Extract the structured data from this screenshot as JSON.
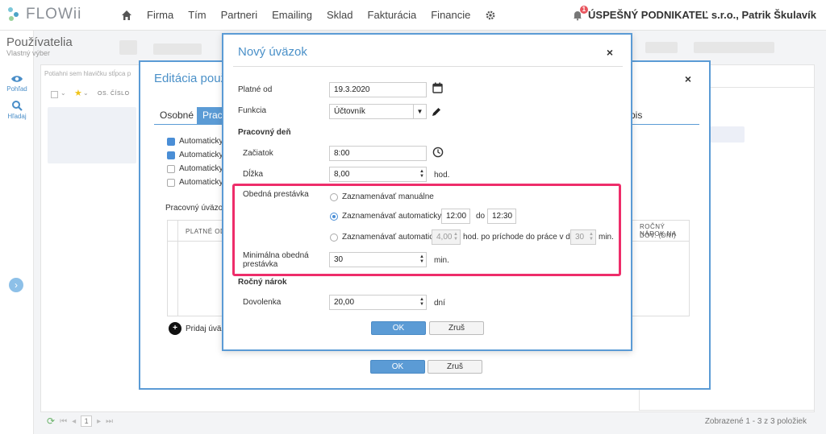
{
  "brand": {
    "name": "FLOWii",
    "colors": {
      "accent": "#5b9bd5",
      "highlight": "#ee2d6a",
      "notification": "#e8545d"
    }
  },
  "nav": {
    "items": [
      "Firma",
      "Tím",
      "Partneri",
      "Emailing",
      "Sklad",
      "Fakturácia",
      "Financie"
    ],
    "home_icon": "home-icon",
    "settings_icon": "gear-icon"
  },
  "user": {
    "name": "ÚSPEŠNÝ PODNIKATEĽ s.r.o., Patrik Škulavík",
    "notifications": "1"
  },
  "sidebar": {
    "items": [
      {
        "label": "Pohľad",
        "icon": "eye-icon"
      },
      {
        "label": "Hľadaj",
        "icon": "search-icon"
      }
    ]
  },
  "page": {
    "title": "Používatelia",
    "subtitle": "Vlastný výber",
    "hint": "Potiahni sem hlavičku stĺpca p",
    "column_num": "OS. ČÍSLO"
  },
  "footer": {
    "page": "1",
    "total": "Zobrazené 1 - 3 z 3 položiek"
  },
  "back_dialog": {
    "title": "Editácia použ",
    "tabs": [
      "Osobné",
      "Prac",
      "pis"
    ],
    "checkboxes": [
      {
        "label": "Automaticky n",
        "checked": true
      },
      {
        "label": "Automaticky s",
        "checked": true
      },
      {
        "label": "Automaticky u",
        "checked": false
      },
      {
        "label": "Automaticky z",
        "checked": false
      }
    ],
    "section": "Pracovný úväzok",
    "columns": [
      "PLATNÉ OD",
      "ROČNÝ NÁROK NA",
      "DOV. (DNI)"
    ],
    "add_label": "Pridaj úväzo",
    "ok": "OK",
    "cancel": "Zruš"
  },
  "dialog": {
    "title": "Nový úväzok",
    "valid_from": {
      "label": "Platné od",
      "value": "19.3.2020"
    },
    "function": {
      "label": "Funkcia",
      "value": "Účtovník"
    },
    "workday": {
      "heading": "Pracovný deň",
      "start": {
        "label": "Začiatok",
        "value": "8:00"
      },
      "length": {
        "label": "Dĺžka",
        "value": "8,00",
        "unit": "hod."
      }
    },
    "lunch": {
      "label": "Obedná prestávka",
      "manual": "Zaznamenávať manuálne",
      "auto_from": "Zaznamenávať automaticky od",
      "from": "12:00",
      "to_label": "do",
      "to": "12:30",
      "auto": "Zaznamenávať automaticky",
      "auto_hours": "4,00",
      "after_arrival": "hod. po príchode do práce v dĺžke",
      "auto_minutes": "30",
      "minutes_unit": "min.",
      "selected": "auto_from"
    },
    "min_lunch": {
      "label_line1": "Minimálna obedná",
      "label_line2": "prestávka",
      "value": "30",
      "unit": "min."
    },
    "annual": {
      "heading": "Ročný nárok",
      "vacation": {
        "label": "Dovolenka",
        "value": "20,00",
        "unit": "dní"
      }
    },
    "ok": "OK",
    "cancel": "Zruš"
  }
}
